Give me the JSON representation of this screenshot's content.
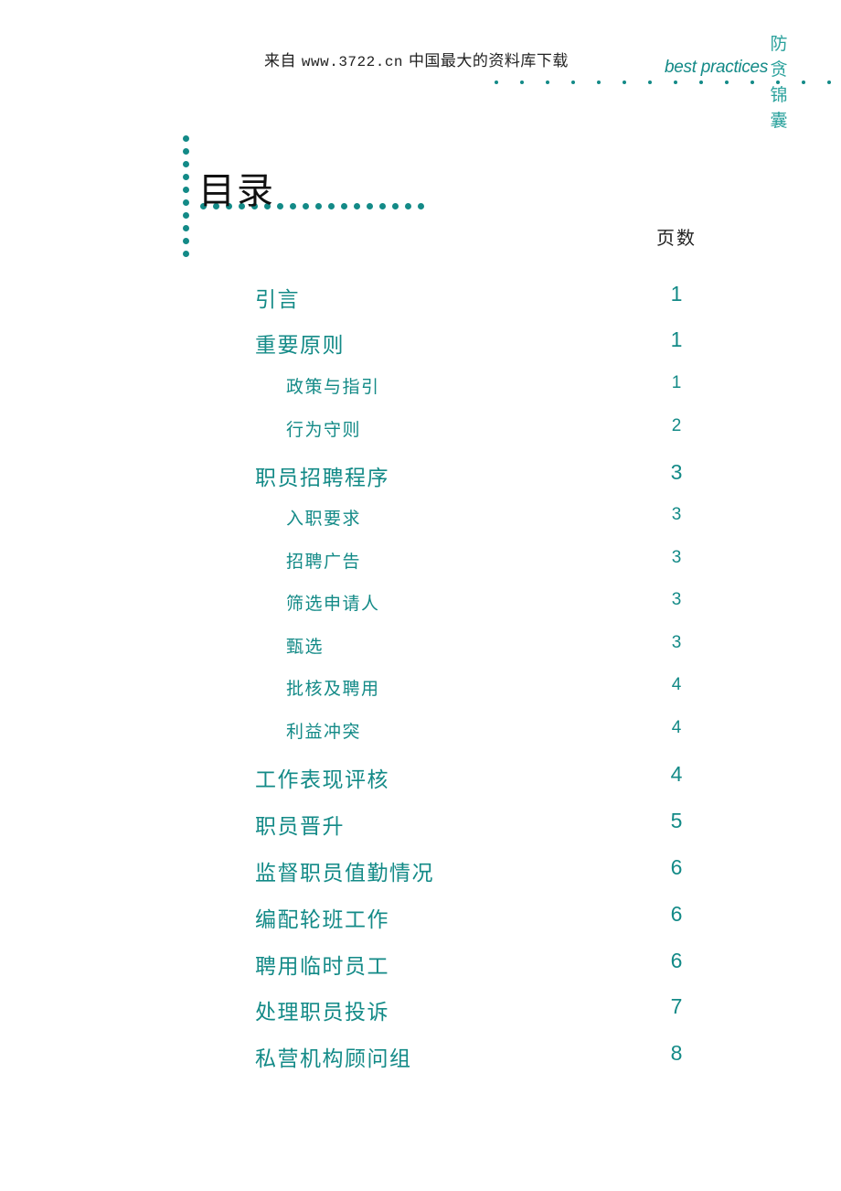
{
  "header": {
    "source_prefix": "来自",
    "source_url": "www.3722.cn",
    "source_suffix": "中国最大的资料库下载",
    "brand_text": "best practices",
    "series_title_chars": [
      "防",
      "贪",
      "锦",
      "囊"
    ]
  },
  "toc": {
    "title": "目录",
    "page_column_label": "页数",
    "entries": [
      {
        "label": "引言",
        "page": "1",
        "level": 1
      },
      {
        "label": "重要原则",
        "page": "1",
        "level": 1
      },
      {
        "label": "政策与指引",
        "page": "1",
        "level": 2
      },
      {
        "label": "行为守则",
        "page": "2",
        "level": 2
      },
      {
        "label": "职员招聘程序",
        "page": "3",
        "level": 1
      },
      {
        "label": "入职要求",
        "page": "3",
        "level": 2
      },
      {
        "label": "招聘广告",
        "page": "3",
        "level": 2
      },
      {
        "label": "筛选申请人",
        "page": "3",
        "level": 2
      },
      {
        "label": "甄选",
        "page": "3",
        "level": 2
      },
      {
        "label": "批核及聘用",
        "page": "4",
        "level": 2
      },
      {
        "label": "利益冲突",
        "page": "4",
        "level": 2
      },
      {
        "label": "工作表现评核",
        "page": "4",
        "level": 1
      },
      {
        "label": "职员晋升",
        "page": "5",
        "level": 1
      },
      {
        "label": "监督职员值勤情况",
        "page": "6",
        "level": 1
      },
      {
        "label": "编配轮班工作",
        "page": "6",
        "level": 1
      },
      {
        "label": "聘用临时员工",
        "page": "6",
        "level": 1
      },
      {
        "label": "处理职员投诉",
        "page": "7",
        "level": 1
      },
      {
        "label": "私营机构顾问组",
        "page": "8",
        "level": 1
      }
    ]
  },
  "colors": {
    "accent_teal": "#138a87",
    "text_dark": "#222222"
  }
}
